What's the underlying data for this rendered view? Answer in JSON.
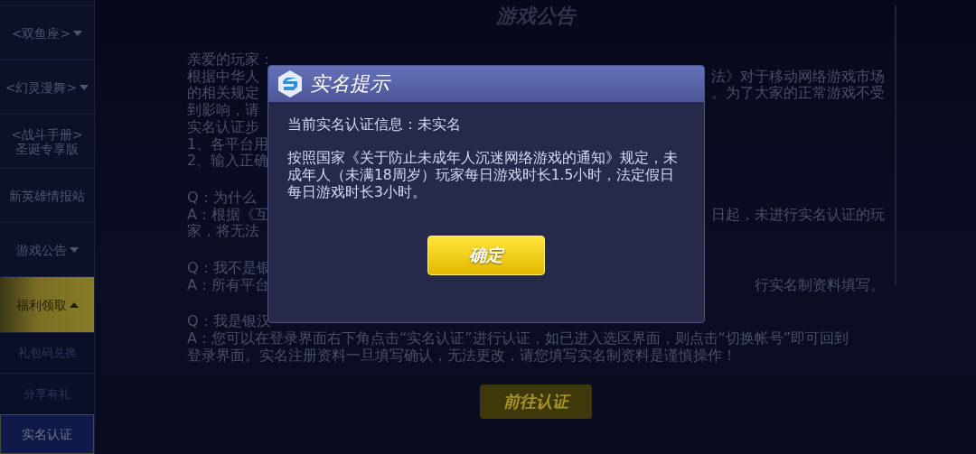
{
  "page_title": "游戏公告",
  "sidebar": {
    "items": [
      {
        "label": "<双鱼座>",
        "kind": "group",
        "expanded": false,
        "selected": false
      },
      {
        "label": "<幻灵漫舞>",
        "kind": "group",
        "expanded": false,
        "selected": false
      },
      {
        "label": "<战斗手册>\n圣诞专享版",
        "kind": "link",
        "selected": false
      },
      {
        "label": "新英雄情报站",
        "kind": "link",
        "selected": false
      },
      {
        "label": "游戏公告",
        "kind": "group",
        "expanded": false,
        "selected": false
      },
      {
        "label": "福利领取",
        "kind": "group",
        "expanded": true,
        "selected": true
      },
      {
        "label": "礼包码兑换",
        "kind": "sub",
        "selected": false
      },
      {
        "label": "分享有礼",
        "kind": "sub",
        "selected": false
      },
      {
        "label": "实名认证",
        "kind": "sub",
        "selected": true
      }
    ]
  },
  "notice": {
    "paragraphs": [
      [
        {
          "left": "亲爱的玩家："
        },
        {
          "left": "根据中华人",
          "right": "法》对于移动网络游戏市场"
        },
        {
          "left": "的相关规定",
          "right": "。为了大家的正常游戏不受"
        },
        {
          "left": "到影响，请"
        },
        {
          "left": "实名认证步"
        },
        {
          "left": "1、各平台用"
        },
        {
          "left": "2、输入正确"
        }
      ],
      [
        {
          "left": "Q：为什么"
        },
        {
          "left": "A：根据《互",
          "right": "日起，未进行实名认证的玩"
        },
        {
          "left": "家，将无法"
        }
      ],
      [
        {
          "left": "Q：我不是银"
        },
        {
          "left": "A：所有平台",
          "right": "行实名制资料填写。"
        }
      ],
      [
        {
          "left": "Q：我是银汉"
        },
        {
          "left": "A：您可以在登录界面右下角点击“实名认证”进行认证，如已进入选区界面，则点击“切换帐号”即可回到"
        },
        {
          "left": "登录界面。实名注册资料一旦填写确认，无法更改，请您填写实名制资料是谨慎操作！"
        }
      ]
    ],
    "button": "前往认证"
  },
  "dialog": {
    "title": "实名提示",
    "status": "当前实名认证信息：未实名",
    "message": "按照国家《关于防止未成年人沉迷网络游戏的通知》规定，未成年人（未满18周岁）玩家每日游戏时长1.5小时，法定假日每日游戏时长3小时。",
    "button": "确定"
  }
}
